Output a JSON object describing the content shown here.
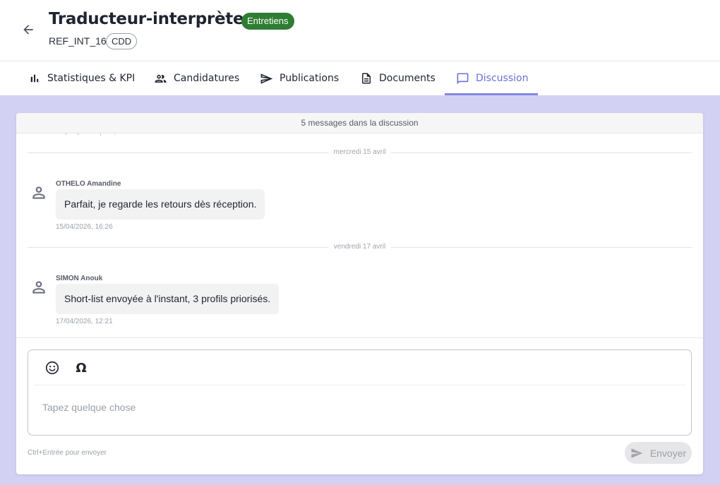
{
  "header": {
    "title": "Traducteur-interprète",
    "status": "Entretiens",
    "status_color": "#2e7d32",
    "reference": "REF_INT_16",
    "contract_type": "CDD"
  },
  "tabs": [
    {
      "label": "Statistiques & KPI",
      "icon": "bar-chart-icon",
      "active": false
    },
    {
      "label": "Candidatures",
      "icon": "people-icon",
      "active": false
    },
    {
      "label": "Publications",
      "icon": "send-icon",
      "active": false
    },
    {
      "label": "Documents",
      "icon": "document-icon",
      "active": false
    },
    {
      "label": "Discussion",
      "icon": "chat-icon",
      "active": true
    }
  ],
  "accent_color": "#6d6fd6",
  "discussion": {
    "count_label": "5 messages dans la discussion",
    "days": [
      {
        "label": "mercredi 15 avril",
        "message": {
          "author": "OTHELO Amandine",
          "text": "Parfait, je regarde les retours dès réception.",
          "timestamp": "15/04/2026, 16:26"
        }
      },
      {
        "label": "vendredi 17 avril",
        "message": {
          "author": "SIMON Anouk",
          "text": "Short-list envoyée à l'instant, 3 profils priorisés.",
          "timestamp": "17/04/2026, 12:21"
        }
      }
    ]
  },
  "composer": {
    "placeholder": "Tapez quelque chose",
    "omega_symbol": "Ω",
    "hint": "Ctrl+Entrée pour envoyer",
    "send_label": "Envoyer"
  }
}
